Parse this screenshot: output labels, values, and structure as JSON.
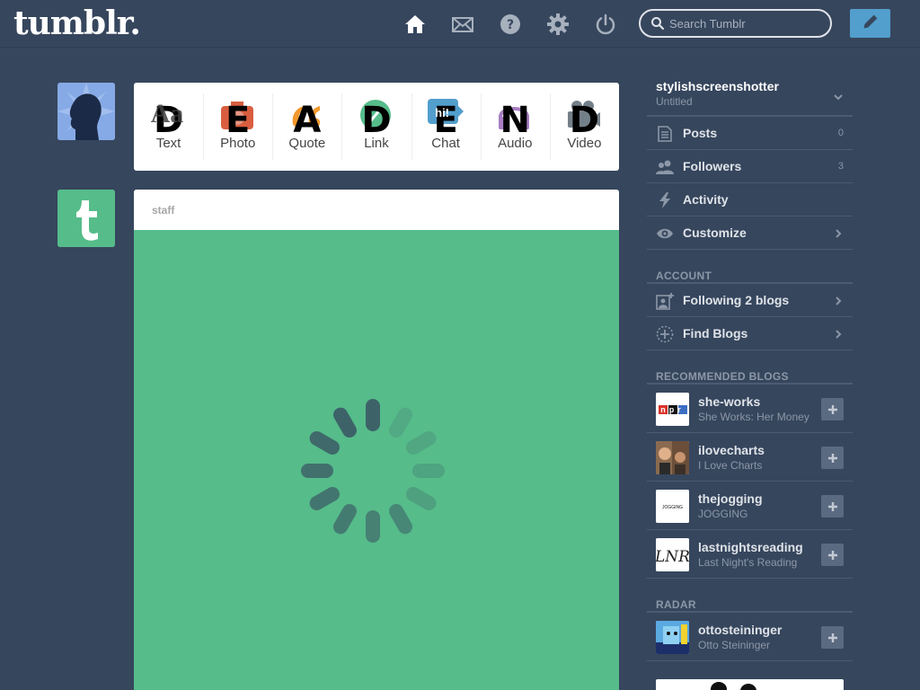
{
  "header": {
    "logo": "tumblr.",
    "search_placeholder": "Search Tumblr",
    "nav_icons": [
      "home-icon",
      "mail-icon",
      "help-icon",
      "gear-icon",
      "power-icon"
    ],
    "compose_icon": "pencil-icon"
  },
  "post_types": [
    {
      "label": "Text",
      "glyph": "D",
      "overlay": "Aa",
      "color": "#444444"
    },
    {
      "label": "Photo",
      "glyph": "E",
      "color": "#d95e40"
    },
    {
      "label": "Quote",
      "glyph": "A",
      "color": "#f2992e"
    },
    {
      "label": "Link",
      "glyph": "D",
      "color": "#56bc8a"
    },
    {
      "label": "Chat",
      "glyph": "E",
      "overlay": "hi!",
      "color": "#529ecc"
    },
    {
      "label": "Audio",
      "glyph": "N",
      "color": "#a77dc2"
    },
    {
      "label": "Video",
      "glyph": "D",
      "color": "#748089"
    }
  ],
  "staff_post": {
    "author": "staff",
    "background": "#56bc8a"
  },
  "sidebar": {
    "blog_name": "stylishscreenshotter",
    "blog_title": "Untitled",
    "menu": [
      {
        "label": "Posts",
        "count": "0",
        "icon": "posts-icon"
      },
      {
        "label": "Followers",
        "count": "3",
        "icon": "followers-icon"
      },
      {
        "label": "Activity",
        "icon": "lightning-icon"
      },
      {
        "label": "Customize",
        "icon": "eye-icon"
      }
    ],
    "account_title": "ACCOUNT",
    "account": [
      {
        "label": "Following 2 blogs",
        "icon": "following-icon"
      },
      {
        "label": "Find Blogs",
        "icon": "find-blogs-icon"
      }
    ],
    "recommended_title": "RECOMMENDED BLOGS",
    "recommended": [
      {
        "name": "she-works",
        "desc": "She Works: Her Money"
      },
      {
        "name": "ilovecharts",
        "desc": "I Love Charts"
      },
      {
        "name": "thejogging",
        "desc": "JOGGING"
      },
      {
        "name": "lastnightsreading",
        "desc": "Last Night's Reading"
      }
    ],
    "radar_title": "RADAR",
    "radar": {
      "name": "ottosteininger",
      "desc": "Otto Steininger"
    }
  },
  "thumb_texts": {
    "npr": "npr",
    "jogging": "JOGGING",
    "lnr": "LNR"
  },
  "colors": {
    "background": "#36465d",
    "accent_blue": "#529ecc",
    "tumblr_green": "#56bc8a"
  }
}
